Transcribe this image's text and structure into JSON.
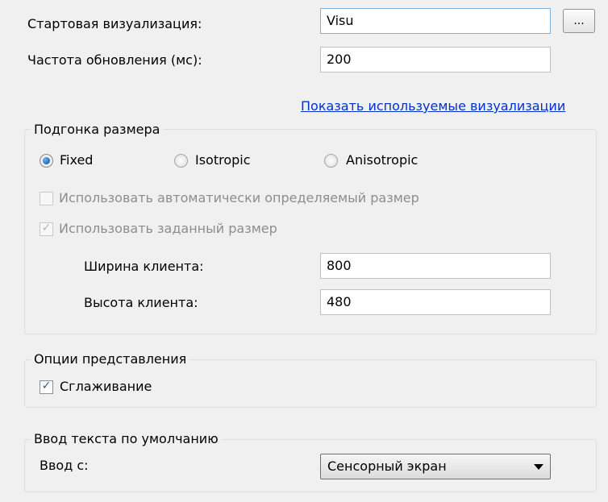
{
  "general": {
    "start_visu_label": "Стартовая визуализация:",
    "start_visu_value": "Visu",
    "browse_button_label": "...",
    "update_rate_label": "Частота обновления (мс):",
    "update_rate_value": "200",
    "show_used_visus_link": "Показать используемые визуализации"
  },
  "scaling": {
    "group_label": "Подгонка размера",
    "options": [
      {
        "label": "Fixed",
        "selected": true
      },
      {
        "label": "Isotropic",
        "selected": false
      },
      {
        "label": "Anisotropic",
        "selected": false
      }
    ],
    "auto_size_label": "Использовать автоматически определяемый размер",
    "auto_size_checked": false,
    "use_specified_label": "Использовать заданный размер",
    "use_specified_checked": true,
    "client_width_label": "Ширина клиента:",
    "client_width_value": "800",
    "client_height_label": "Высота клиента:",
    "client_height_value": "480"
  },
  "presentation": {
    "group_label": "Опции представления",
    "antialiasing_label": "Сглаживание",
    "antialiasing_checked": true
  },
  "text_input": {
    "group_label": "Ввод текста по умолчанию",
    "input_with_label": "Ввод с:",
    "input_with_value": "Сенсорный экран"
  }
}
